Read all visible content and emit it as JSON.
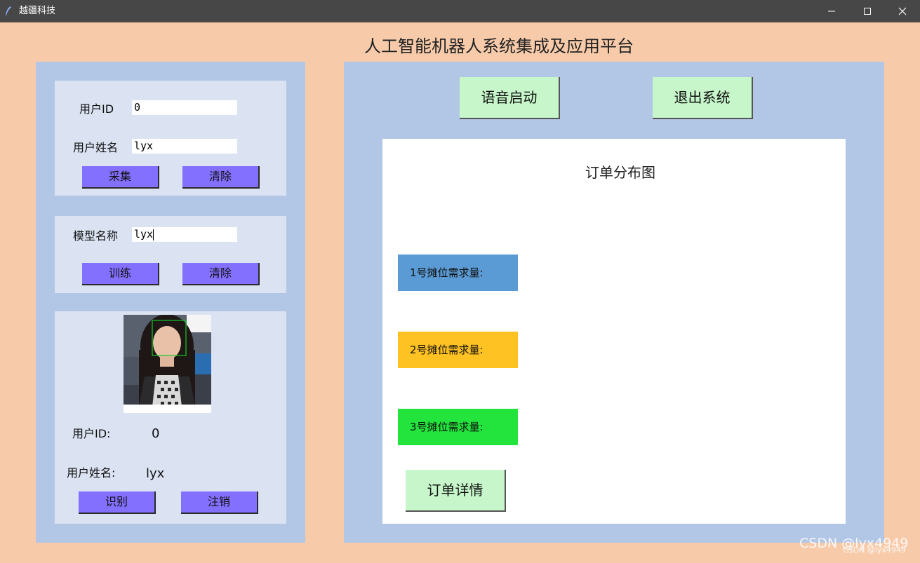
{
  "window": {
    "title": "越疆科技",
    "controls": [
      "minimize-icon",
      "maximize-icon",
      "close-icon"
    ]
  },
  "app": {
    "title": "人工智能机器人系统集成及应用平台"
  },
  "collect": {
    "user_id_label": "用户ID",
    "user_id_value": "0",
    "user_name_label": "用户姓名",
    "user_name_value": "lyx",
    "collect_button": "采集",
    "clear_button": "清除"
  },
  "train": {
    "model_name_label": "模型名称",
    "model_name_value": "lyx",
    "train_button": "训练",
    "clear_button": "清除"
  },
  "recognize": {
    "user_id_label": "用户ID:",
    "user_id_value": "0",
    "user_name_label": "用户姓名:",
    "user_name_value": "lyx",
    "recognize_button": "识别",
    "logout_button": "注销"
  },
  "controls": {
    "voice_start_button": "语音启动",
    "exit_button": "退出系统"
  },
  "orders": {
    "title": "订单分布图",
    "stalls": [
      {
        "label": "1号摊位需求量:",
        "color": "#5b9bd5"
      },
      {
        "label": "2号摊位需求量:",
        "color": "#ffc223"
      },
      {
        "label": "3号摊位需求量:",
        "color": "#22e43c"
      }
    ],
    "details_button": "订单详情"
  },
  "colors": {
    "background": "#f7cbaa",
    "panel": "#b2c6e6",
    "box": "#dbe3f3",
    "purple_button": "#8470ff",
    "green_button": "#c6f6c9"
  },
  "watermark": {
    "large": "CSDN @lyx4949",
    "small": "CSDN @lyx4949"
  }
}
